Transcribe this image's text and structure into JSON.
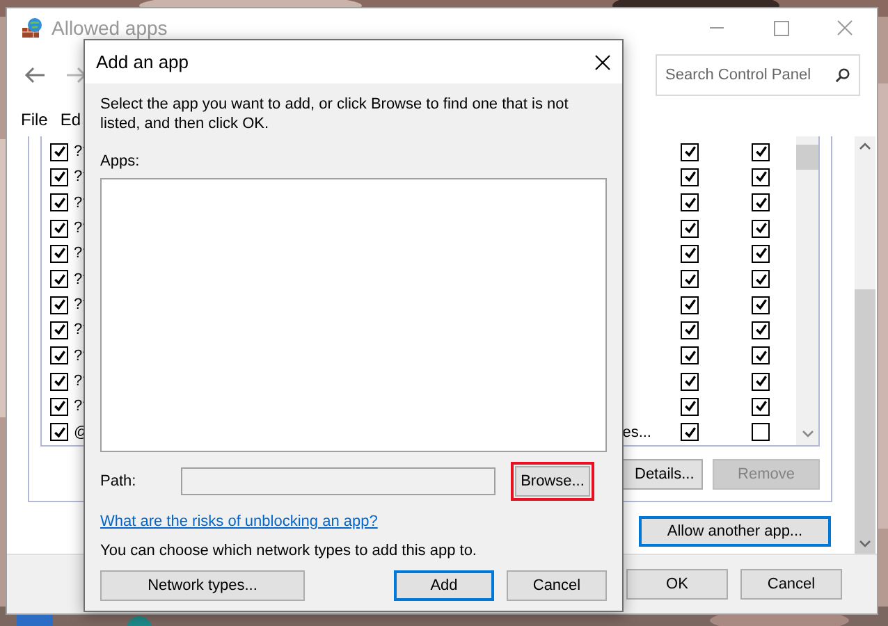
{
  "background_window": {
    "title": "Allowed apps",
    "active": false,
    "search": {
      "placeholder": "Search Control Panel"
    },
    "menu": [
      "File",
      "Ed"
    ],
    "app_rows": [
      {
        "checked": true,
        "name": "??",
        "column_2": true,
        "column_3": true
      },
      {
        "checked": true,
        "name": "??",
        "column_2": true,
        "column_3": true
      },
      {
        "checked": true,
        "name": "??",
        "column_2": true,
        "column_3": true
      },
      {
        "checked": true,
        "name": "??",
        "column_2": true,
        "column_3": true
      },
      {
        "checked": true,
        "name": "??",
        "column_2": true,
        "column_3": true
      },
      {
        "checked": true,
        "name": "??",
        "column_2": true,
        "column_3": true
      },
      {
        "checked": true,
        "name": "??",
        "column_2": true,
        "column_3": true
      },
      {
        "checked": true,
        "name": "??",
        "column_2": true,
        "column_3": true
      },
      {
        "checked": true,
        "name": "??",
        "column_2": true,
        "column_3": true
      },
      {
        "checked": true,
        "name": "??",
        "column_2": true,
        "column_3": true
      },
      {
        "checked": true,
        "name": "??",
        "column_2": true,
        "column_3": true
      },
      {
        "checked": true,
        "name": "@",
        "name_tail": "es...",
        "column_2": true,
        "column_3": false
      }
    ],
    "list_buttons": [
      {
        "label": "Details...",
        "disabled": false
      },
      {
        "label": "Remove",
        "disabled": true
      }
    ],
    "allow_another_app_button": {
      "label": "Allow another app...",
      "default": true
    },
    "buttons": [
      {
        "label": "OK",
        "default": false
      },
      {
        "label": "Cancel",
        "default": false
      }
    ]
  },
  "dialog": {
    "title": "Add an app",
    "instructions": "Select the app you want to add, or click Browse to find one that is not listed, and then click OK.",
    "apps_label": "Apps:",
    "path_label": "Path:",
    "path_field": {
      "disabled": true
    },
    "browse_button": {
      "label": "Browse...",
      "highlighted": true
    },
    "link": "What are the risks of unblocking an app?",
    "note": "You can choose which network types to add this app to.",
    "buttons": [
      {
        "kind": "secondary",
        "label": "Network types...",
        "default": false
      },
      {
        "kind": "main",
        "label": "Add",
        "default": true
      },
      {
        "kind": "main",
        "label": "Cancel",
        "default": false
      }
    ]
  }
}
